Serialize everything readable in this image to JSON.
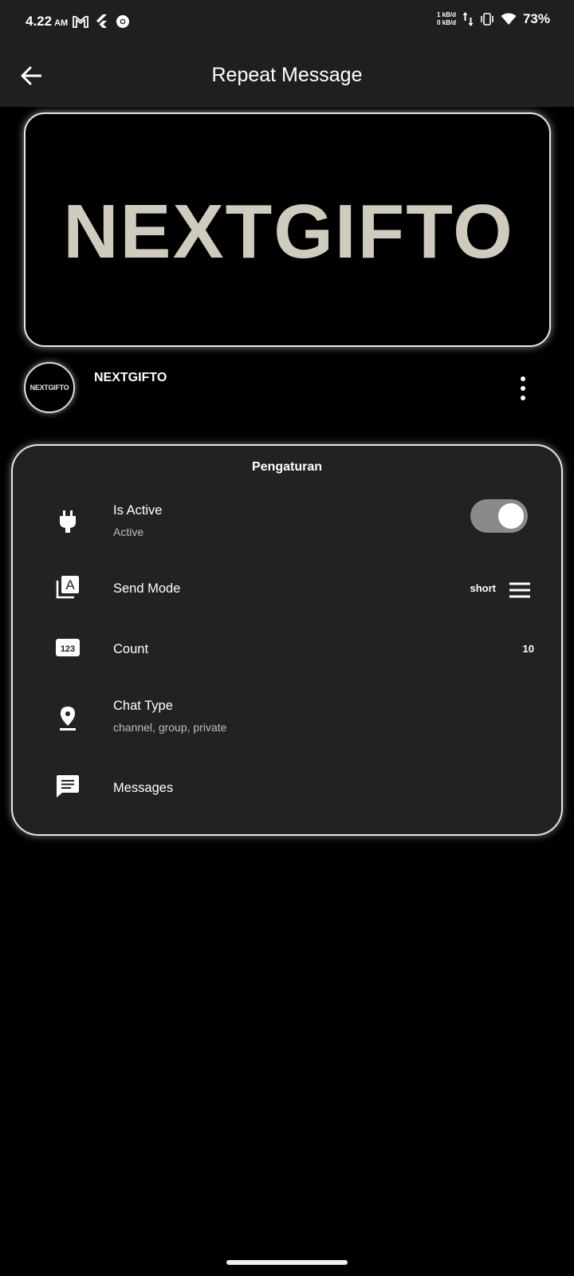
{
  "status_bar": {
    "time": "4.22",
    "ampm": "AM",
    "speed_up": "1 kB/d",
    "speed_down": "0 kB/d",
    "battery": "73%"
  },
  "app_bar": {
    "title": "Repeat Message"
  },
  "banner": {
    "logo_text": "NEXTGIFTO"
  },
  "profile": {
    "avatar_text": "NEXTGIFTO",
    "name": "NEXTGIFTO"
  },
  "settings": {
    "title": "Pengaturan",
    "is_active": {
      "label": "Is Active",
      "subtitle": "Active",
      "enabled": true
    },
    "send_mode": {
      "label": "Send Mode",
      "value": "short"
    },
    "count": {
      "label": "Count",
      "value": "10"
    },
    "chat_type": {
      "label": "Chat Type",
      "subtitle": "channel, group, private"
    },
    "messages": {
      "label": "Messages"
    }
  },
  "icons": {
    "back": "arrow-left-icon",
    "more": "more-vert-icon",
    "plug": "power-plug-icon",
    "send_mode": "font-download-icon",
    "count": "numbers-123-icon",
    "chat_type": "location-pin-icon",
    "messages": "message-icon",
    "menu": "menu-lines-icon"
  }
}
